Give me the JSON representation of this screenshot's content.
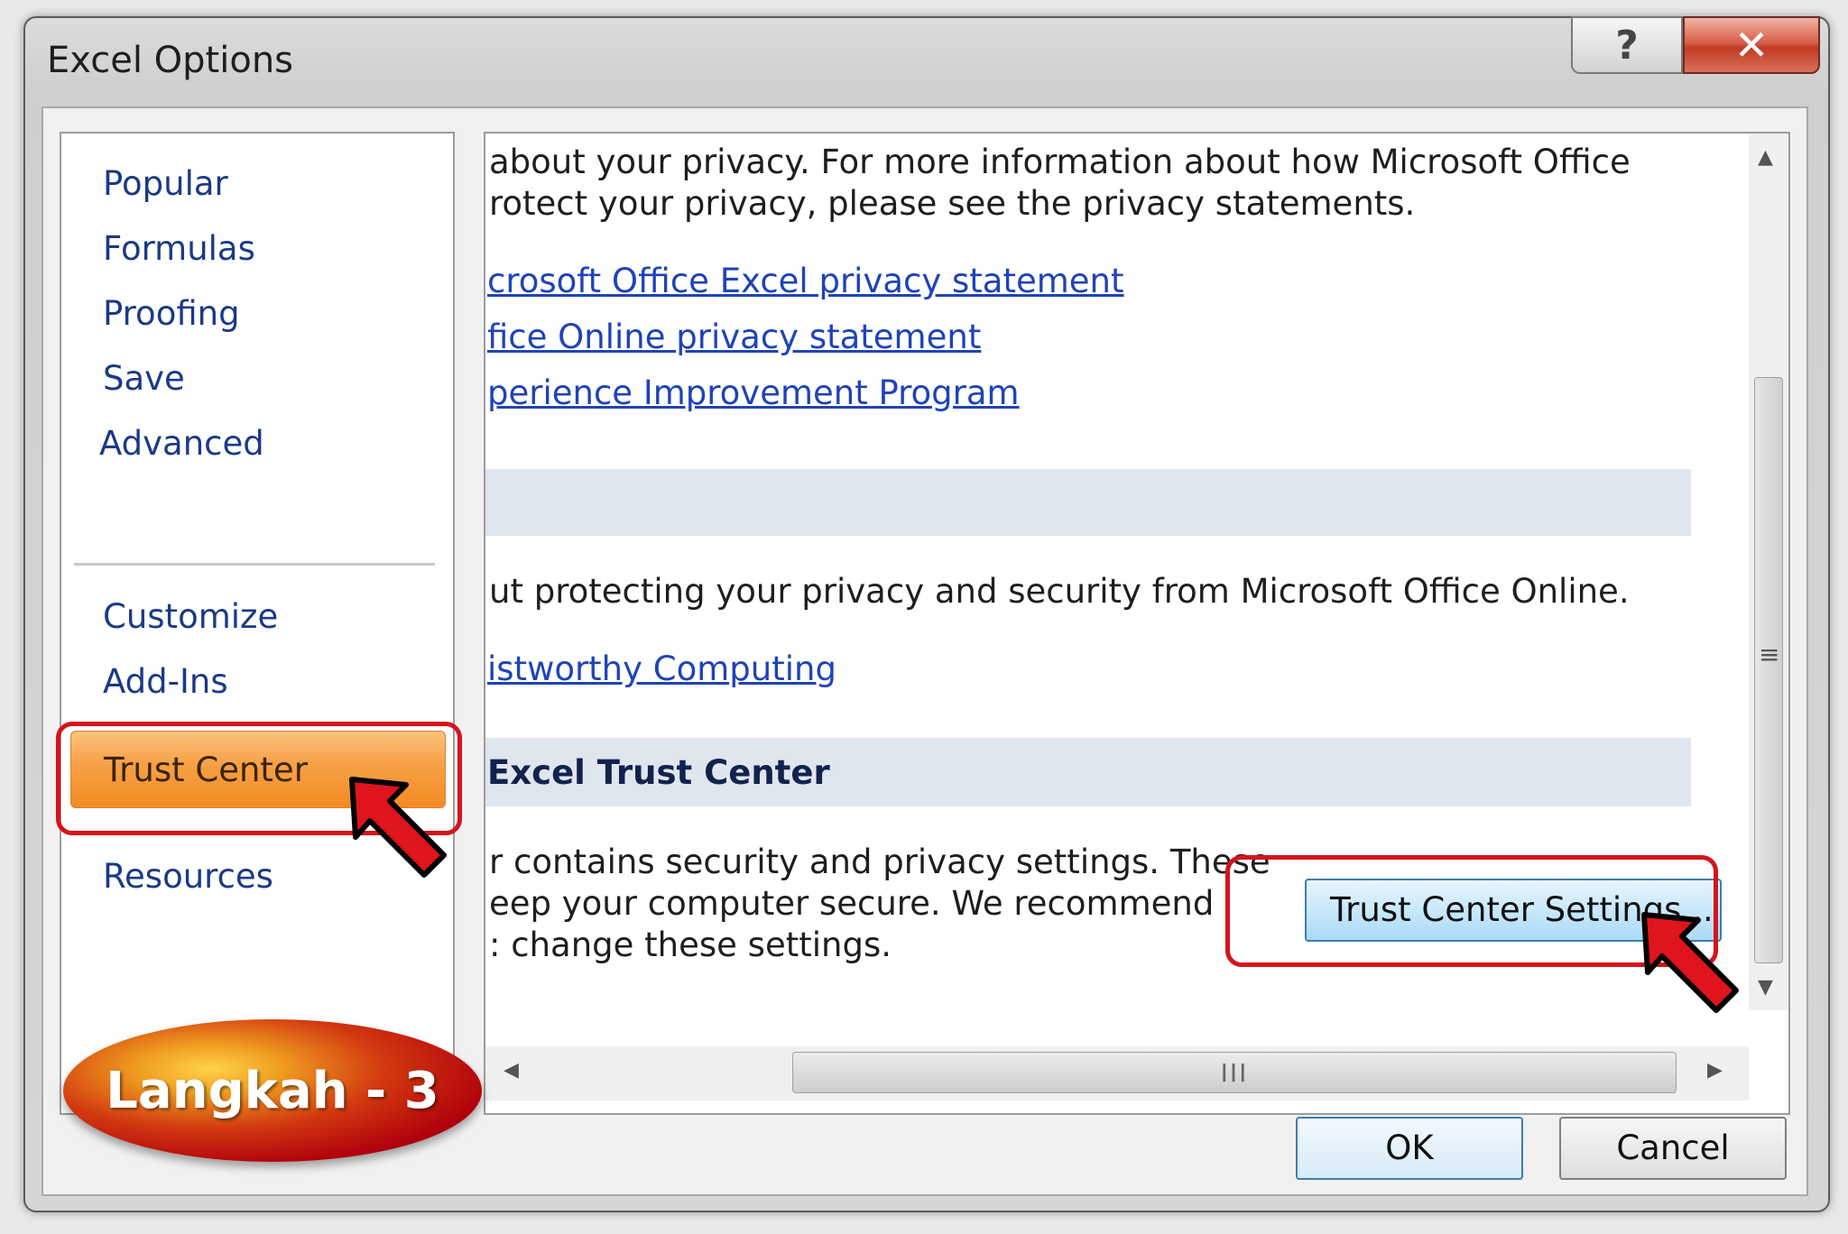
{
  "window": {
    "title": "Excel Options",
    "help_symbol": "?",
    "close_symbol": "✕"
  },
  "nav": {
    "items": [
      "Popular",
      "Formulas",
      "Proofing",
      "Save",
      "Advanced",
      "Customize",
      "Add-Ins",
      "Trust Center",
      "Resources"
    ],
    "selected": "Trust Center"
  },
  "content": {
    "privacy_text_line1": "about your privacy. For more information about how Microsoft Office",
    "privacy_text_line2": "rotect your privacy, please see the privacy statements.",
    "link_excel_privacy": "crosoft Office Excel privacy statement",
    "link_online_privacy": "fice Online privacy statement",
    "link_experience": "perience Improvement Program",
    "security_text": "ut protecting your privacy and security from Microsoft Office Online.",
    "link_trustworthy": "istworthy Computing",
    "section_title": "Excel Trust Center",
    "trust_text_line1": "r contains security and privacy settings. These",
    "trust_text_line2": "eep your computer secure. We recommend",
    "trust_text_line3": ": change these settings.",
    "trust_button": "Trust Center Settings..."
  },
  "scrollbars": {
    "vertical_grip": "≡",
    "horizontal_grip": "III",
    "left_arrow": "◀",
    "right_arrow": "▶",
    "up_arrow": "▲",
    "down_arrow": "▼"
  },
  "buttons": {
    "ok": "OK",
    "cancel": "Cancel"
  },
  "annotation": {
    "badge": "Langkah - 3",
    "highlight_color": "#d4141c"
  },
  "colors": {
    "selected_nav": "#f7a24a",
    "link": "#1f43b8",
    "button_border": "#3c7fb1"
  }
}
